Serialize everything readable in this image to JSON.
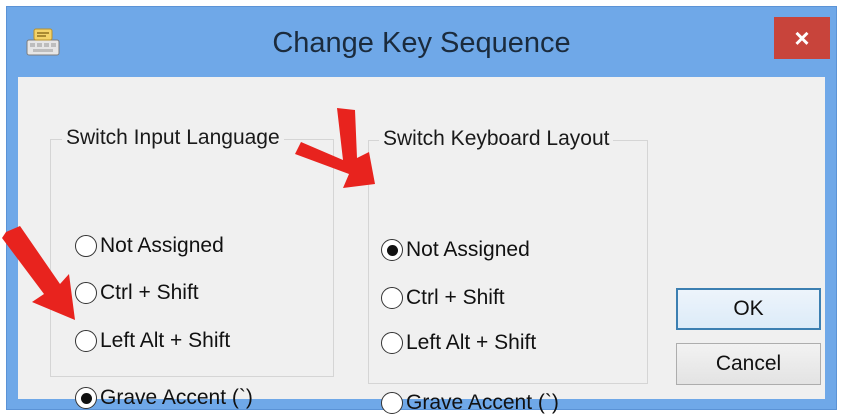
{
  "window": {
    "title": "Change Key Sequence",
    "close_label": "×",
    "title_bar_color": "#6fa8e8",
    "close_button_color": "#c8443b"
  },
  "switch_input_language": {
    "title": "Switch Input Language",
    "options": [
      "Not Assigned",
      "Ctrl + Shift",
      "Left Alt + Shift",
      "Grave Accent (`)"
    ],
    "selected": "Grave Accent (`)"
  },
  "switch_keyboard_layout": {
    "title": "Switch Keyboard Layout",
    "options": [
      "Not Assigned",
      "Ctrl + Shift",
      "Left Alt + Shift",
      "Grave Accent (`)"
    ],
    "selected": "Not Assigned"
  },
  "buttons": {
    "ok": "OK",
    "cancel": "Cancel"
  },
  "icons": {
    "app": "keyboard-icon",
    "close": "close-icon",
    "annotation": "red-arrow-annotation"
  }
}
